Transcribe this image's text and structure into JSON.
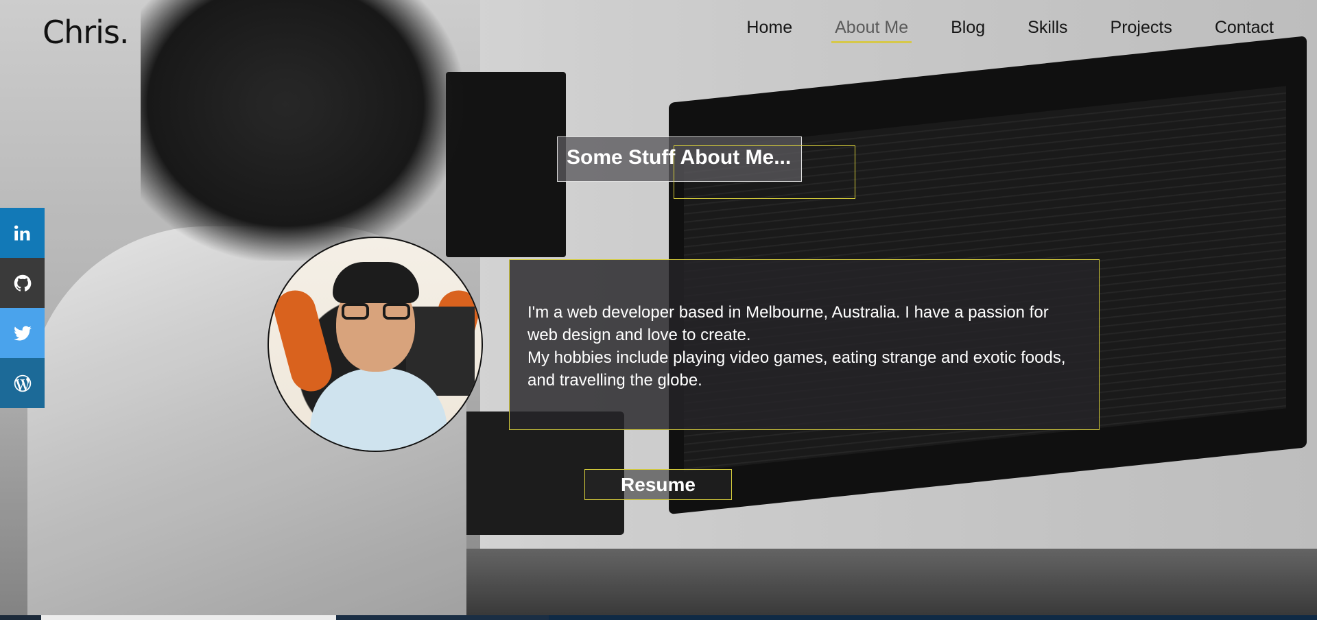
{
  "site": {
    "logo": "Chris."
  },
  "nav": {
    "items": [
      {
        "label": "Home",
        "active": false
      },
      {
        "label": "About Me",
        "active": true
      },
      {
        "label": "Blog",
        "active": false
      },
      {
        "label": "Skills",
        "active": false
      },
      {
        "label": "Projects",
        "active": false
      },
      {
        "label": "Contact",
        "active": false
      }
    ]
  },
  "social": [
    {
      "icon": "linkedin-icon",
      "color": "#1279b7"
    },
    {
      "icon": "github-icon",
      "color": "#3a3a3a"
    },
    {
      "icon": "twitter-icon",
      "color": "#4aa3ec"
    },
    {
      "icon": "wordpress-icon",
      "color": "#1c6a98"
    }
  ],
  "about": {
    "heading": "Some Stuff About Me...",
    "paragraph_1": "I'm a web developer based in Melbourne, Australia. I have a passion for web design and love to create.",
    "paragraph_2": "My hobbies include playing video games, eating strange and exotic foods, and travelling the globe.",
    "resume_label": "Resume"
  },
  "colors": {
    "accent": "#d6cd3c",
    "panel": "#262428"
  }
}
